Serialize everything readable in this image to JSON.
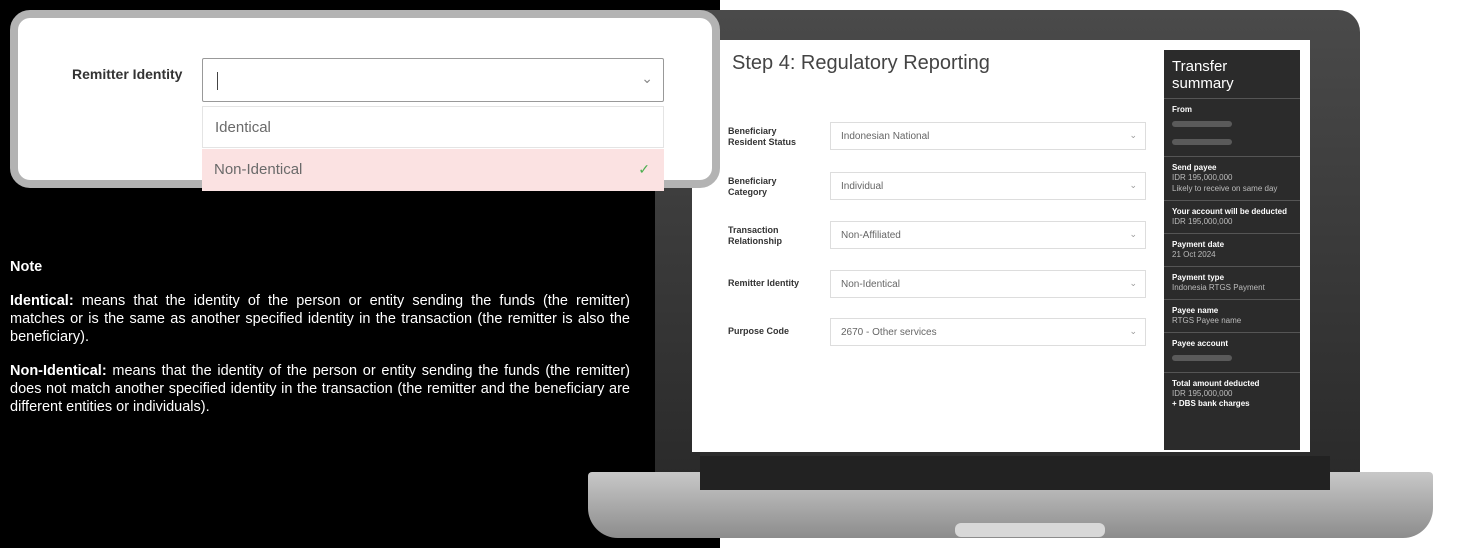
{
  "zoom": {
    "label": "Remitter Identity",
    "options": [
      "Identical",
      "Non-Identical"
    ]
  },
  "note": {
    "heading": "Note",
    "identical_term": "Identical:",
    "identical_text": " means that the identity of the person or entity sending the funds (the remitter) matches or is the same as another specified identity in the transaction (the remitter is also the beneficiary).",
    "non_identical_term": "Non-Identical:",
    "non_identical_text": " means that the identity of the person or entity sending the funds (the remitter) does not match another specified identity in the transaction (the remitter and the beneficiary are different entities or individuals)."
  },
  "screen": {
    "title": "Step 4: Regulatory Reporting",
    "fields": [
      {
        "label": "Beneficiary Resident Status",
        "value": "Indonesian National"
      },
      {
        "label": "Beneficiary Category",
        "value": "Individual"
      },
      {
        "label": "Transaction Relationship",
        "value": "Non-Affiliated"
      },
      {
        "label": "Remitter Identity",
        "value": "Non-Identical"
      },
      {
        "label": "Purpose Code",
        "value": "2670 - Other services"
      }
    ]
  },
  "summary": {
    "title": "Transfer summary",
    "from": "From",
    "send_payee": "Send payee",
    "send_amount": "IDR 195,000,000",
    "send_note": "Likely to receive on same day",
    "deducted_label": "Your account will be deducted",
    "deducted_amount": "IDR 195,000,000",
    "payment_date_label": "Payment date",
    "payment_date": "21 Oct 2024",
    "payment_type_label": "Payment type",
    "payment_type": "Indonesia RTGS Payment",
    "payee_name_label": "Payee name",
    "payee_name": "RTGS Payee name",
    "payee_account_label": "Payee account",
    "total_label": "Total amount deducted",
    "total_amount": "IDR 195,000,000",
    "charges": "+ DBS bank charges"
  }
}
